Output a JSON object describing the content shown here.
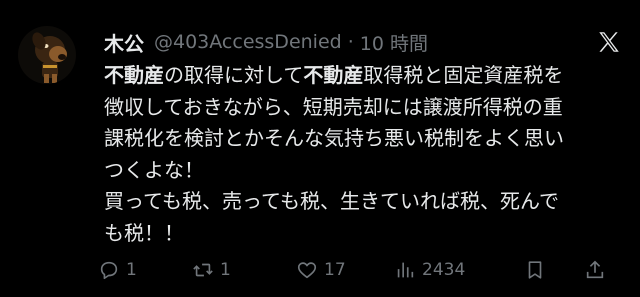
{
  "post": {
    "display_name": "木公",
    "handle": "@403AccessDenied",
    "separator": "·",
    "time": "10 時間",
    "lines": [
      [
        {
          "t": "不動産",
          "b": true
        },
        {
          "t": "の取得に対して",
          "b": false
        },
        {
          "t": "不動産",
          "b": true
        },
        {
          "t": "取得税と固定資産税を",
          "b": false
        }
      ],
      [
        {
          "t": "徴収しておきながら、短期売却には譲渡所得税の重",
          "b": false
        }
      ],
      [
        {
          "t": "課税化を検討とかそんな気持ち悪い税制をよく思い",
          "b": false
        }
      ],
      [
        {
          "t": "つくよな！",
          "b": false
        }
      ],
      [
        {
          "t": "買っても税、売っても税、生きていれば税、死んで",
          "b": false
        }
      ],
      [
        {
          "t": "も税！！",
          "b": false
        }
      ]
    ]
  },
  "actions": {
    "reply_count": "1",
    "repost_count": "1",
    "like_count": "17",
    "view_count": "2434"
  },
  "icons": {
    "logo": "x-logo-icon",
    "reply": "reply-icon",
    "repost": "repost-icon",
    "like": "heart-icon",
    "views": "views-icon",
    "bookmark": "bookmark-icon",
    "share": "share-icon"
  },
  "colors": {
    "background": "#000000",
    "text": "#e7e9ea",
    "muted": "#71767b"
  }
}
